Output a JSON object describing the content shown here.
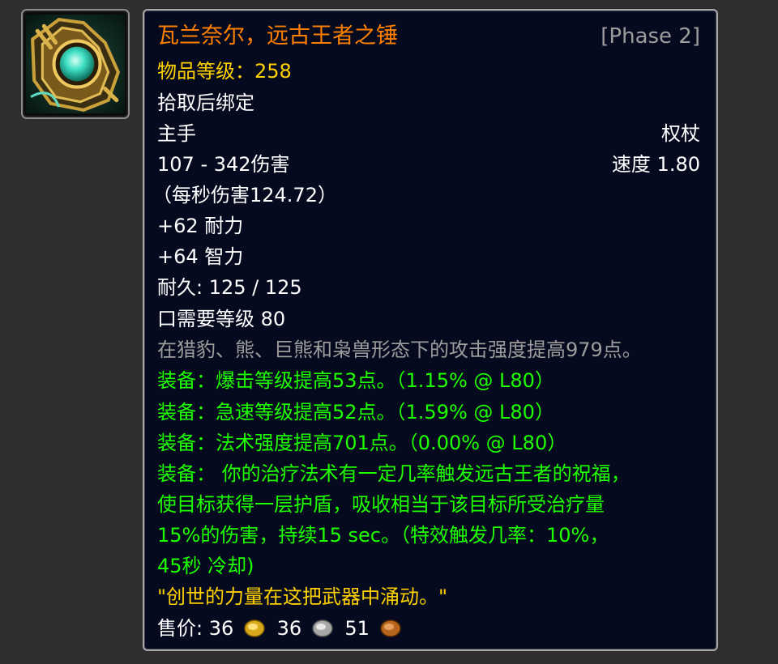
{
  "item": {
    "icon": "mace-icon",
    "name": "瓦兰奈尔，远古王者之锤",
    "phase": "[Phase 2]",
    "item_level": "物品等级：258",
    "binding": "拾取后绑定",
    "slot": "主手",
    "weapon_type": "权杖",
    "damage": "107 - 342伤害",
    "speed": "速度 1.80",
    "dps": "（每秒伤害124.72）",
    "stats": [
      "+62 耐力",
      "+64 智力"
    ],
    "durability": "耐久: 125 / 125",
    "requirement": "口需要等级 80",
    "passive": "在猎豹、熊、巨熊和枭兽形态下的攻击强度提高979点。",
    "equips": [
      "装备：爆击等级提高53点。（1.15% @ L80）",
      "装备：急速等级提高52点。（1.59% @ L80）",
      "装备：法术强度提高701点。（0.00% @ L80）"
    ],
    "proc_lines": [
      "装备： 你的治疗法术有一定几率触发远古王者的祝福，",
      "使目标获得一层护盾，吸收相当于该目标所受治疗量",
      "15%的伤害，持续15 sec。（特效触发几率：10%，",
      "45秒 冷却)"
    ],
    "flavor": "\"创世的力量在这把武器中涌动。\"",
    "sell_label": "售价:",
    "gold": "36",
    "silver": "36",
    "copper": "51"
  },
  "colors": {
    "background": "#2e2e2e",
    "tooltip_bg": "#060a1f",
    "legendary_orange": "#ff8000",
    "yellow": "#ffd100",
    "green": "#1eff00",
    "gray": "#9d9d9d"
  }
}
